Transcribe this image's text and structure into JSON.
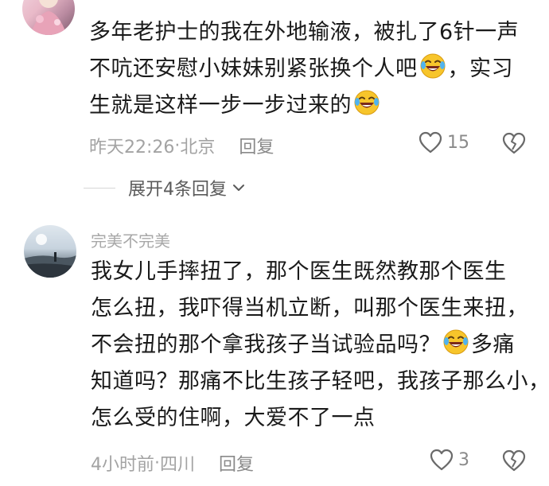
{
  "comments": [
    {
      "username": "",
      "lines": [
        [
          "多年老护士的我在外地输液，被扎了6针一声"
        ],
        [
          "不吭还安慰小妹妹别紧张换个人吧",
          "emoji",
          "，实习"
        ],
        [
          "生就是这样一步一步过来的",
          "emoji"
        ]
      ],
      "time": "昨天22:26",
      "location": "北京",
      "reply_label": "回复",
      "likes": "15"
    },
    {
      "username": "完美不完美",
      "lines": [
        [
          "我女儿手摔扭了，那个医生既然教那个医生"
        ],
        [
          "怎么扭，我吓得当机立断，叫那个医生来扭，"
        ],
        [
          "不会扭的那个拿我孩子当试验品吗？",
          "emoji",
          "多痛"
        ],
        [
          "知道吗？那痛不比生孩子轻吧，我孩子那么小，"
        ],
        [
          "怎么受的住啊，大爱不了一点"
        ]
      ],
      "time": "4小时前",
      "location": "四川",
      "reply_label": "回复",
      "likes": "3"
    }
  ],
  "expand_replies": "展开4条回复",
  "meta_separator": " · ",
  "icons": {
    "like": "heart-outline-icon",
    "dislike": "broken-heart-icon",
    "expand": "chevron-down-icon",
    "emoji": "laughing-tears-emoji-icon"
  },
  "colors": {
    "text": "#1a1a1a",
    "muted": "#a3a3a3",
    "reply": "#8a8a8a",
    "emoji_face": "#f7c52b"
  }
}
